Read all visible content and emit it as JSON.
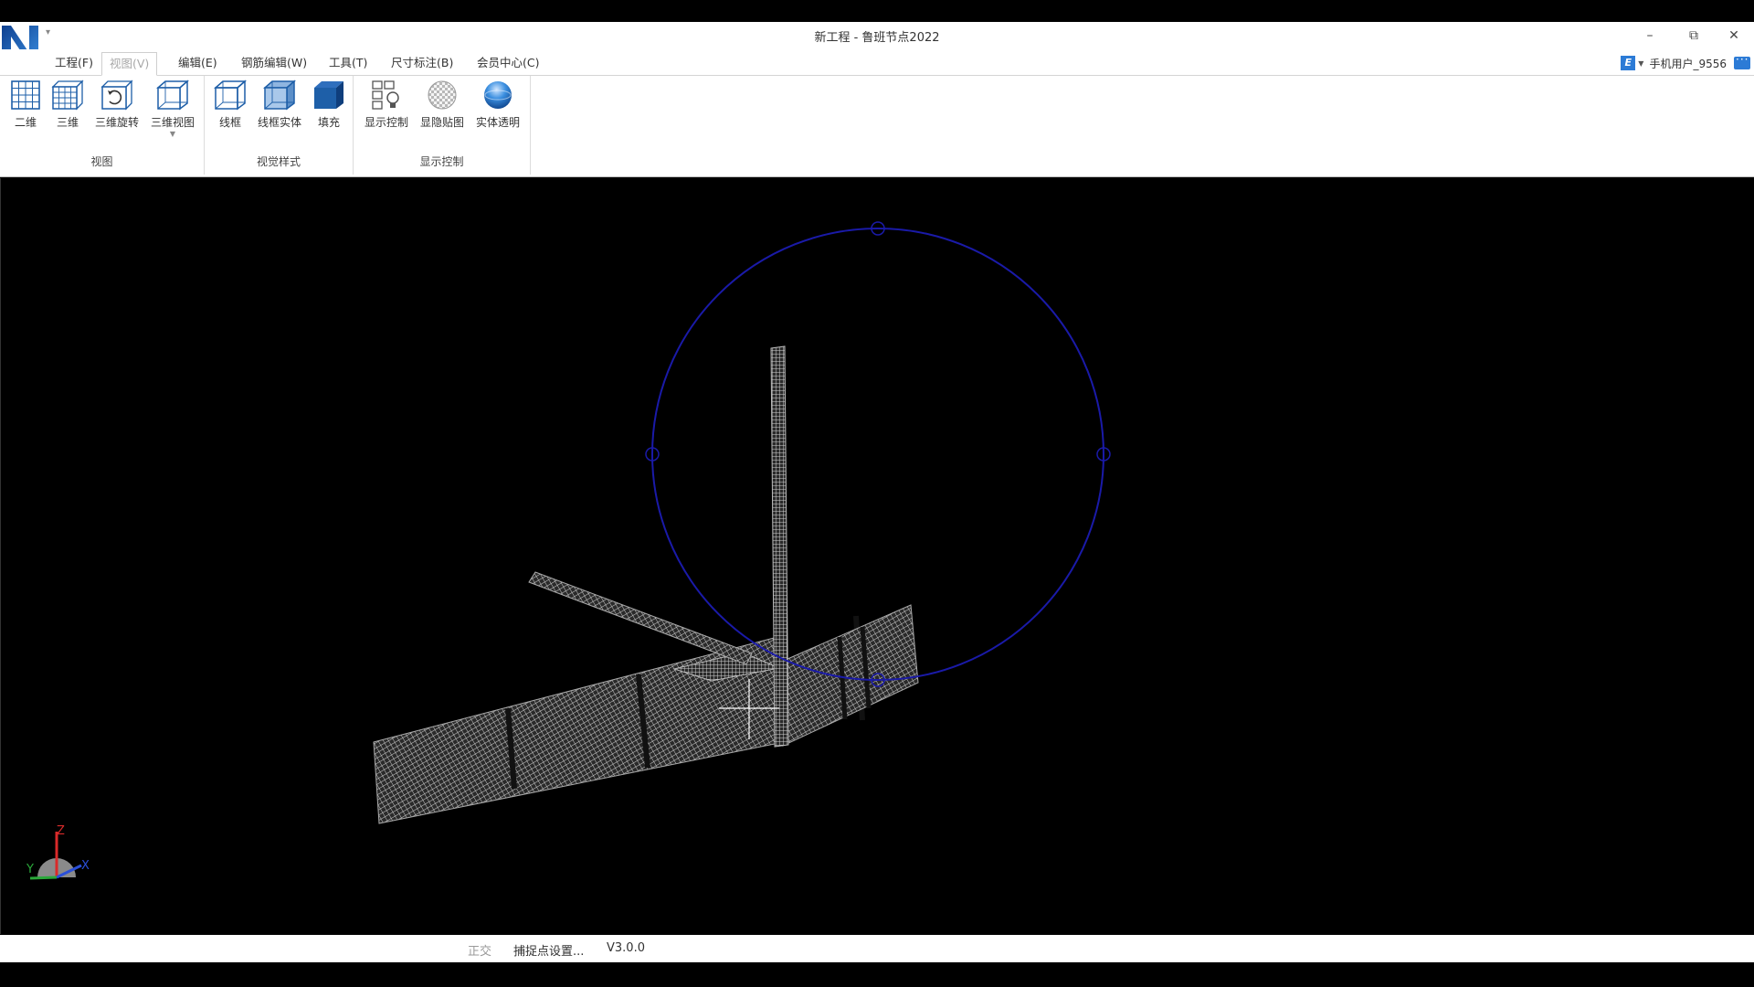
{
  "window": {
    "title": "新工程 - 鲁班节点2022",
    "logo_letter": "N",
    "controls": {
      "minimize_glyph": "–",
      "restore_glyph": "⧉",
      "close_glyph": "✕"
    }
  },
  "menu": {
    "items": [
      {
        "label": "工程(F)"
      },
      {
        "label": "视图(V)"
      },
      {
        "label": "编辑(E)"
      },
      {
        "label": "钢筋编辑(W)"
      },
      {
        "label": "工具(T)"
      },
      {
        "label": "尺寸标注(B)"
      },
      {
        "label": "会员中心(C)"
      }
    ],
    "active_index": 1
  },
  "user": {
    "badge": "E",
    "name": "手机用户_9556"
  },
  "ribbon": {
    "groups": [
      {
        "label": "视图",
        "buttons": [
          "二维",
          "三维",
          "三维旋转",
          "三维视图"
        ]
      },
      {
        "label": "视觉样式",
        "buttons": [
          "线框",
          "线框实体",
          "填充"
        ]
      },
      {
        "label": "显示控制",
        "buttons": [
          "显示控制",
          "显隐贴图",
          "实体透明"
        ]
      }
    ]
  },
  "axes": {
    "z": "Z",
    "y": "Y",
    "x": "X"
  },
  "status": {
    "mode": "正交",
    "snap": "捕捉点设置...",
    "version": "V3.0.0"
  },
  "colors": {
    "accent": "#1e5fa8",
    "orbit_circle": "#1a1aa8",
    "model_mesh": "#cfcfcf",
    "axis_z": "#d92a2a",
    "axis_x": "#2a4fd9",
    "axis_y": "#2aa83a"
  }
}
